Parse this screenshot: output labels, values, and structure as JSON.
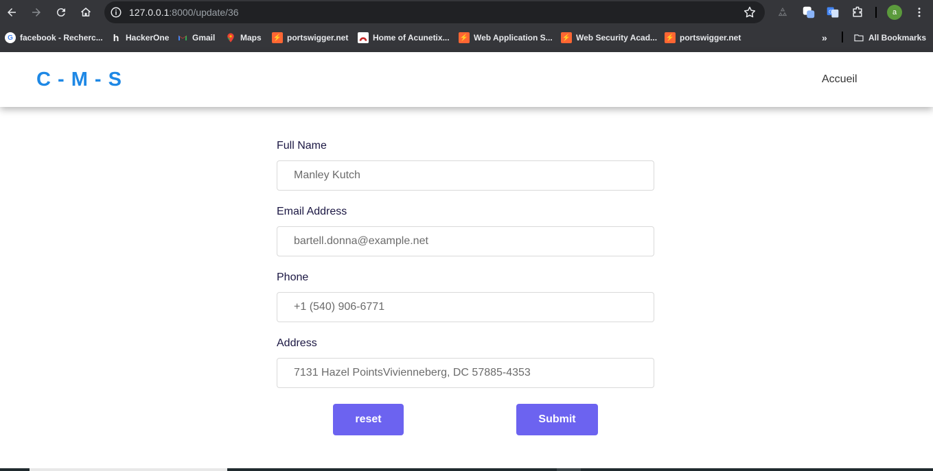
{
  "browser": {
    "url_host": "127.0.0.1",
    "url_rest": ":8000/update/36",
    "avatar_letter": "a",
    "bookmarks": [
      {
        "label": "facebook - Recherc...",
        "icon": "google-icon"
      },
      {
        "label": "HackerOne",
        "icon": "hackerone-icon"
      },
      {
        "label": "Gmail",
        "icon": "gmail-icon"
      },
      {
        "label": "Maps",
        "icon": "maps-icon"
      },
      {
        "label": "portswigger.net",
        "icon": "portswigger-icon"
      },
      {
        "label": "Home of Acunetix...",
        "icon": "acunetix-icon"
      },
      {
        "label": "Web Application S...",
        "icon": "portswigger-icon"
      },
      {
        "label": "Web Security Acad...",
        "icon": "portswigger-icon"
      },
      {
        "label": "portswigger.net",
        "icon": "portswigger-icon"
      }
    ],
    "all_bookmarks_label": "All Bookmarks"
  },
  "header": {
    "logo": "C - M - S",
    "nav": "Accueil"
  },
  "form": {
    "full_name": {
      "label": "Full Name",
      "value": "Manley Kutch"
    },
    "email": {
      "label": "Email Address",
      "value": "bartell.donna@example.net"
    },
    "phone": {
      "label": "Phone",
      "value": "+1 (540) 906-6771"
    },
    "address": {
      "label": "Address",
      "value": "7131 Hazel PointsVivienneberg, DC 57885-4353"
    },
    "reset_label": "reset",
    "submit_label": "Submit"
  },
  "colors": {
    "accent": "#6c63f0",
    "logo": "#1e88e5",
    "chrome": "#35363a"
  }
}
